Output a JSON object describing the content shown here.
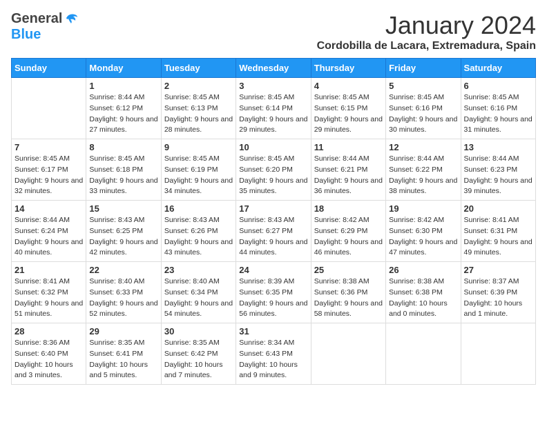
{
  "header": {
    "logo_general": "General",
    "logo_blue": "Blue",
    "month": "January 2024",
    "location": "Cordobilla de Lacara, Extremadura, Spain"
  },
  "weekdays": [
    "Sunday",
    "Monday",
    "Tuesday",
    "Wednesday",
    "Thursday",
    "Friday",
    "Saturday"
  ],
  "weeks": [
    [
      {
        "day": "",
        "sunrise": "",
        "sunset": "",
        "daylight": ""
      },
      {
        "day": "1",
        "sunrise": "Sunrise: 8:44 AM",
        "sunset": "Sunset: 6:12 PM",
        "daylight": "Daylight: 9 hours and 27 minutes."
      },
      {
        "day": "2",
        "sunrise": "Sunrise: 8:45 AM",
        "sunset": "Sunset: 6:13 PM",
        "daylight": "Daylight: 9 hours and 28 minutes."
      },
      {
        "day": "3",
        "sunrise": "Sunrise: 8:45 AM",
        "sunset": "Sunset: 6:14 PM",
        "daylight": "Daylight: 9 hours and 29 minutes."
      },
      {
        "day": "4",
        "sunrise": "Sunrise: 8:45 AM",
        "sunset": "Sunset: 6:15 PM",
        "daylight": "Daylight: 9 hours and 29 minutes."
      },
      {
        "day": "5",
        "sunrise": "Sunrise: 8:45 AM",
        "sunset": "Sunset: 6:16 PM",
        "daylight": "Daylight: 9 hours and 30 minutes."
      },
      {
        "day": "6",
        "sunrise": "Sunrise: 8:45 AM",
        "sunset": "Sunset: 6:16 PM",
        "daylight": "Daylight: 9 hours and 31 minutes."
      }
    ],
    [
      {
        "day": "7",
        "sunrise": "Sunrise: 8:45 AM",
        "sunset": "Sunset: 6:17 PM",
        "daylight": "Daylight: 9 hours and 32 minutes."
      },
      {
        "day": "8",
        "sunrise": "Sunrise: 8:45 AM",
        "sunset": "Sunset: 6:18 PM",
        "daylight": "Daylight: 9 hours and 33 minutes."
      },
      {
        "day": "9",
        "sunrise": "Sunrise: 8:45 AM",
        "sunset": "Sunset: 6:19 PM",
        "daylight": "Daylight: 9 hours and 34 minutes."
      },
      {
        "day": "10",
        "sunrise": "Sunrise: 8:45 AM",
        "sunset": "Sunset: 6:20 PM",
        "daylight": "Daylight: 9 hours and 35 minutes."
      },
      {
        "day": "11",
        "sunrise": "Sunrise: 8:44 AM",
        "sunset": "Sunset: 6:21 PM",
        "daylight": "Daylight: 9 hours and 36 minutes."
      },
      {
        "day": "12",
        "sunrise": "Sunrise: 8:44 AM",
        "sunset": "Sunset: 6:22 PM",
        "daylight": "Daylight: 9 hours and 38 minutes."
      },
      {
        "day": "13",
        "sunrise": "Sunrise: 8:44 AM",
        "sunset": "Sunset: 6:23 PM",
        "daylight": "Daylight: 9 hours and 39 minutes."
      }
    ],
    [
      {
        "day": "14",
        "sunrise": "Sunrise: 8:44 AM",
        "sunset": "Sunset: 6:24 PM",
        "daylight": "Daylight: 9 hours and 40 minutes."
      },
      {
        "day": "15",
        "sunrise": "Sunrise: 8:43 AM",
        "sunset": "Sunset: 6:25 PM",
        "daylight": "Daylight: 9 hours and 42 minutes."
      },
      {
        "day": "16",
        "sunrise": "Sunrise: 8:43 AM",
        "sunset": "Sunset: 6:26 PM",
        "daylight": "Daylight: 9 hours and 43 minutes."
      },
      {
        "day": "17",
        "sunrise": "Sunrise: 8:43 AM",
        "sunset": "Sunset: 6:27 PM",
        "daylight": "Daylight: 9 hours and 44 minutes."
      },
      {
        "day": "18",
        "sunrise": "Sunrise: 8:42 AM",
        "sunset": "Sunset: 6:29 PM",
        "daylight": "Daylight: 9 hours and 46 minutes."
      },
      {
        "day": "19",
        "sunrise": "Sunrise: 8:42 AM",
        "sunset": "Sunset: 6:30 PM",
        "daylight": "Daylight: 9 hours and 47 minutes."
      },
      {
        "day": "20",
        "sunrise": "Sunrise: 8:41 AM",
        "sunset": "Sunset: 6:31 PM",
        "daylight": "Daylight: 9 hours and 49 minutes."
      }
    ],
    [
      {
        "day": "21",
        "sunrise": "Sunrise: 8:41 AM",
        "sunset": "Sunset: 6:32 PM",
        "daylight": "Daylight: 9 hours and 51 minutes."
      },
      {
        "day": "22",
        "sunrise": "Sunrise: 8:40 AM",
        "sunset": "Sunset: 6:33 PM",
        "daylight": "Daylight: 9 hours and 52 minutes."
      },
      {
        "day": "23",
        "sunrise": "Sunrise: 8:40 AM",
        "sunset": "Sunset: 6:34 PM",
        "daylight": "Daylight: 9 hours and 54 minutes."
      },
      {
        "day": "24",
        "sunrise": "Sunrise: 8:39 AM",
        "sunset": "Sunset: 6:35 PM",
        "daylight": "Daylight: 9 hours and 56 minutes."
      },
      {
        "day": "25",
        "sunrise": "Sunrise: 8:38 AM",
        "sunset": "Sunset: 6:36 PM",
        "daylight": "Daylight: 9 hours and 58 minutes."
      },
      {
        "day": "26",
        "sunrise": "Sunrise: 8:38 AM",
        "sunset": "Sunset: 6:38 PM",
        "daylight": "Daylight: 10 hours and 0 minutes."
      },
      {
        "day": "27",
        "sunrise": "Sunrise: 8:37 AM",
        "sunset": "Sunset: 6:39 PM",
        "daylight": "Daylight: 10 hours and 1 minute."
      }
    ],
    [
      {
        "day": "28",
        "sunrise": "Sunrise: 8:36 AM",
        "sunset": "Sunset: 6:40 PM",
        "daylight": "Daylight: 10 hours and 3 minutes."
      },
      {
        "day": "29",
        "sunrise": "Sunrise: 8:35 AM",
        "sunset": "Sunset: 6:41 PM",
        "daylight": "Daylight: 10 hours and 5 minutes."
      },
      {
        "day": "30",
        "sunrise": "Sunrise: 8:35 AM",
        "sunset": "Sunset: 6:42 PM",
        "daylight": "Daylight: 10 hours and 7 minutes."
      },
      {
        "day": "31",
        "sunrise": "Sunrise: 8:34 AM",
        "sunset": "Sunset: 6:43 PM",
        "daylight": "Daylight: 10 hours and 9 minutes."
      },
      {
        "day": "",
        "sunrise": "",
        "sunset": "",
        "daylight": ""
      },
      {
        "day": "",
        "sunrise": "",
        "sunset": "",
        "daylight": ""
      },
      {
        "day": "",
        "sunrise": "",
        "sunset": "",
        "daylight": ""
      }
    ]
  ]
}
